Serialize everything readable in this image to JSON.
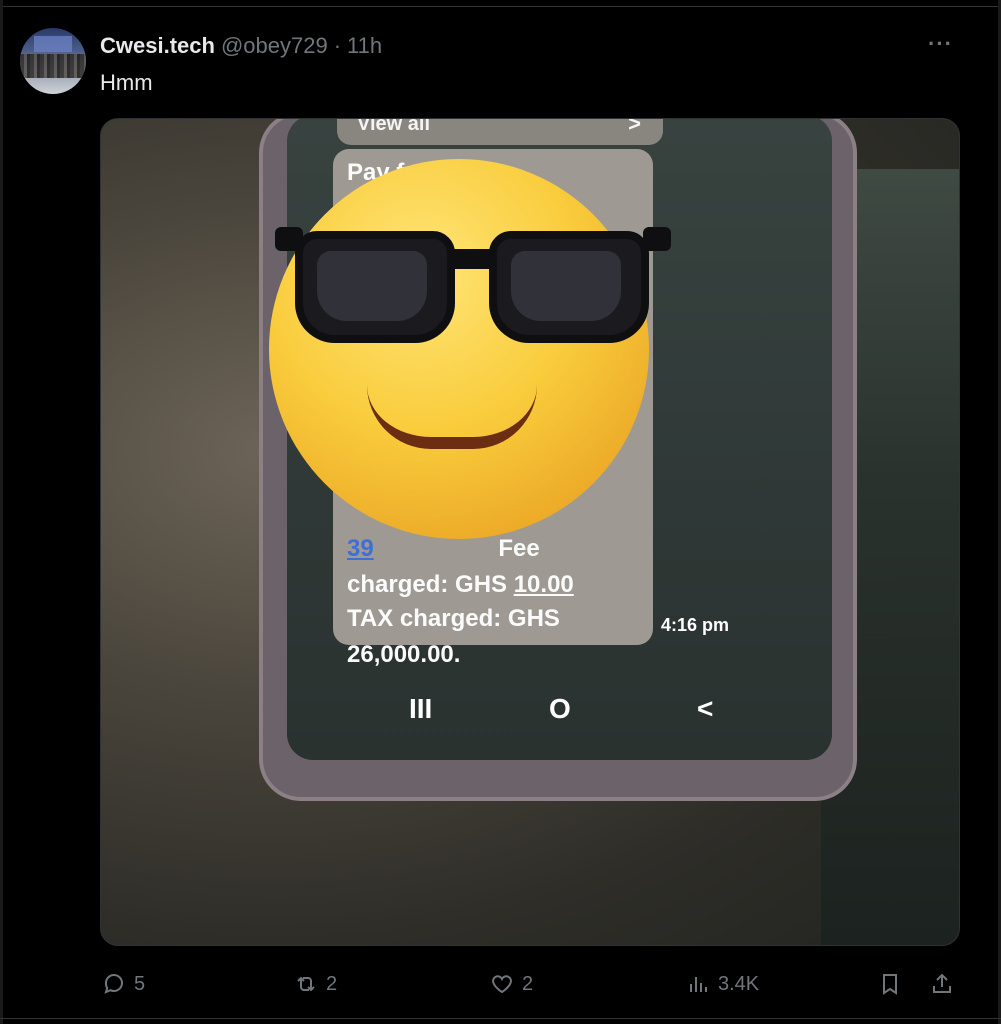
{
  "tweet": {
    "author_name": "Cwesi.tech",
    "handle": "@obey729",
    "separator": "·",
    "time": "11h",
    "more_icon": "···",
    "text": "Hmm"
  },
  "media": {
    "view_all": "View all",
    "view_all_chevron": ">",
    "sms_line1": "Pay           for",
    "sms_line2_prefix": "39",
    "sms_line2_suffix": "Fee",
    "sms_line3_prefix": "charged: GHS ",
    "sms_line3_amount": "10.00",
    "sms_line4": "TAX charged: GHS",
    "sms_line5": "26,000.00.",
    "sms_time": "4:16 pm",
    "nav_recent": "III",
    "nav_home": "O",
    "nav_back": "<"
  },
  "actions": {
    "replies": "5",
    "reposts": "2",
    "likes": "2",
    "views": "3.4K"
  },
  "icons": {
    "reply": "reply-icon",
    "repost": "repost-icon",
    "like": "heart-icon",
    "views": "views-icon",
    "bookmark": "bookmark-icon",
    "share": "share-icon",
    "more": "more-icon",
    "emoji": "sunglasses-emoji"
  },
  "colors": {
    "background": "#000000",
    "text_primary": "#e7e9ea",
    "text_secondary": "#71767b",
    "border": "#2f3336"
  }
}
